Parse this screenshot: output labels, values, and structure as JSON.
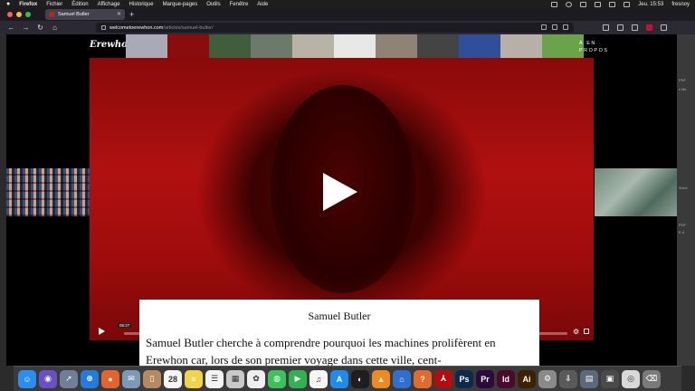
{
  "menubar": {
    "app": "Firefox",
    "items": [
      "Fichier",
      "Édition",
      "Affichage",
      "Historique",
      "Marque-pages",
      "Outils",
      "Fenêtre",
      "Aide"
    ],
    "clock": "Jeu. 15:53",
    "user": "fresnoy"
  },
  "browser": {
    "tab_title": "Samuel Butler",
    "url_host": "welcometoerewhon.com",
    "url_path": "/articles/samuel-butler/"
  },
  "site": {
    "logo": "Erewhon",
    "about_link": "À EN PROPOS",
    "thumb_colors": [
      "#a9a9b8",
      "#8a0d0d",
      "#3f5e3c",
      "#6b7a6a",
      "#b9b3a7",
      "#e8e8e6",
      "#8e8374",
      "#444",
      "#2f4f9a",
      "#b8b0a8",
      "#6aa34a"
    ]
  },
  "video": {
    "timecode": "05:27",
    "progress": 0
  },
  "article": {
    "title": "Samuel Butler",
    "body": "Samuel Butler cherche à comprendre pourquoi les machines prolifèrent en Erewhon car, lors de son premier voyage dans cette ville, cent-"
  },
  "desktop_labels": [
    "PDF",
    "e file",
    "Word",
    "PDF",
    "E-4"
  ],
  "dock": {
    "apps": [
      {
        "name": "finder",
        "color": "#2a8ef0",
        "glyph": "☺"
      },
      {
        "name": "siri",
        "color": "#6a4fc7",
        "glyph": "◉"
      },
      {
        "name": "launchpad",
        "color": "#6e7f96",
        "glyph": "➚"
      },
      {
        "name": "safari",
        "color": "#1f7ce0",
        "glyph": "⊕"
      },
      {
        "name": "firefox",
        "color": "#e8632b",
        "glyph": "●"
      },
      {
        "name": "mail",
        "color": "#7d9ab5",
        "glyph": "✉"
      },
      {
        "name": "contacts",
        "color": "#b68a5e",
        "glyph": "▯"
      },
      {
        "name": "calendar",
        "color": "#f4f4f4",
        "glyph": "28"
      },
      {
        "name": "notes",
        "color": "#f3d34a",
        "glyph": "≡"
      },
      {
        "name": "reminders",
        "color": "#f4f4f4",
        "glyph": "☰"
      },
      {
        "name": "preview",
        "color": "#c9c9c9",
        "glyph": "▦"
      },
      {
        "name": "photos",
        "color": "#efefef",
        "glyph": "✿"
      },
      {
        "name": "messages",
        "color": "#3ac35a",
        "glyph": "◍"
      },
      {
        "name": "facetime",
        "color": "#2fb34f",
        "glyph": "▶"
      },
      {
        "name": "music",
        "color": "#f5f5f5",
        "glyph": "♫"
      },
      {
        "name": "app-store",
        "color": "#1d8cf0",
        "glyph": "A"
      },
      {
        "name": "vpn",
        "color": "#1e1e1e",
        "glyph": "◐"
      },
      {
        "name": "vlc",
        "color": "#f08a1c",
        "glyph": "▲"
      },
      {
        "name": "keynote",
        "color": "#2e6fd1",
        "glyph": "⌂"
      },
      {
        "name": "pages",
        "color": "#e36a2b",
        "glyph": "?"
      },
      {
        "name": "acrobat",
        "color": "#b50d0d",
        "glyph": "⅄"
      },
      {
        "name": "photoshop",
        "color": "#0d2a4a",
        "glyph": "Ps"
      },
      {
        "name": "premiere",
        "color": "#2b0a3d",
        "glyph": "Pr"
      },
      {
        "name": "indesign",
        "color": "#4a0a2a",
        "glyph": "Id"
      },
      {
        "name": "illustrator",
        "color": "#3d2200",
        "glyph": "Ai"
      },
      {
        "name": "system-preferences",
        "color": "#8a8a8a",
        "glyph": "⚙"
      },
      {
        "name": "downloads",
        "color": "#5a5a5a",
        "glyph": "⇩"
      },
      {
        "name": "documents",
        "color": "#5a6a7a",
        "glyph": "▤"
      },
      {
        "name": "screenshots",
        "color": "#4a4a4a",
        "glyph": "▣"
      },
      {
        "name": "dvd",
        "color": "#d8d8d8",
        "glyph": "◎"
      },
      {
        "name": "trash",
        "color": "#7a7a7a",
        "glyph": "⌫"
      }
    ]
  }
}
